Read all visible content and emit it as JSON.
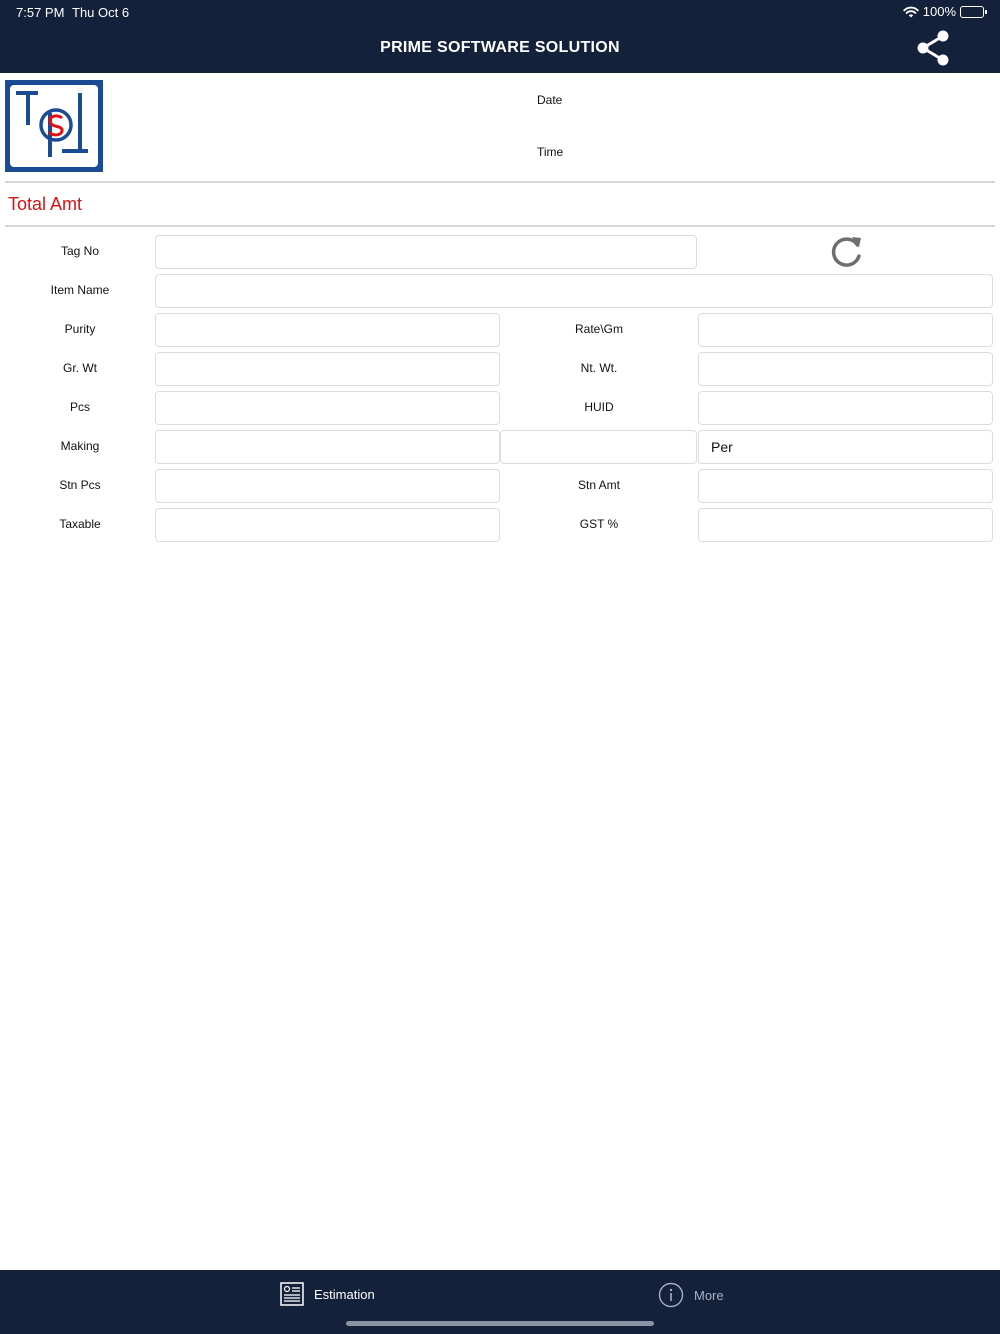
{
  "status_bar": {
    "time": "7:57 PM",
    "date": "Thu Oct 6",
    "battery": "100%"
  },
  "app": {
    "title": "PRIME SOFTWARE SOLUTION"
  },
  "header": {
    "date_label": "Date",
    "time_label": "Time",
    "total_label": "Total Amt"
  },
  "colors": {
    "navy": "#14213a",
    "accent_red": "#e01010",
    "logo_blue": "#1a4c96"
  },
  "form": {
    "tag_no": {
      "label": "Tag No",
      "value": ""
    },
    "item_name": {
      "label": "Item Name",
      "value": ""
    },
    "purity": {
      "label": "Purity",
      "value": ""
    },
    "rate_gm": {
      "label": "Rate\\Gm",
      "value": ""
    },
    "gr_wt": {
      "label": "Gr. Wt",
      "value": ""
    },
    "nt_wt": {
      "label": "Nt. Wt.",
      "value": ""
    },
    "pcs": {
      "label": "Pcs",
      "value": ""
    },
    "huid": {
      "label": "HUID",
      "value": ""
    },
    "making": {
      "label": "Making",
      "value": "",
      "value2": "",
      "type_selected": "Per"
    },
    "stn_pcs": {
      "label": "Stn Pcs",
      "value": ""
    },
    "stn_amt": {
      "label": "Stn Amt",
      "value": ""
    },
    "taxable": {
      "label": "Taxable",
      "value": ""
    },
    "gst": {
      "label": "GST %",
      "value": ""
    }
  },
  "tabs": [
    {
      "label": "Estimation",
      "icon": "document-list-icon",
      "active": true
    },
    {
      "label": "More",
      "icon": "info-icon",
      "active": false
    }
  ]
}
